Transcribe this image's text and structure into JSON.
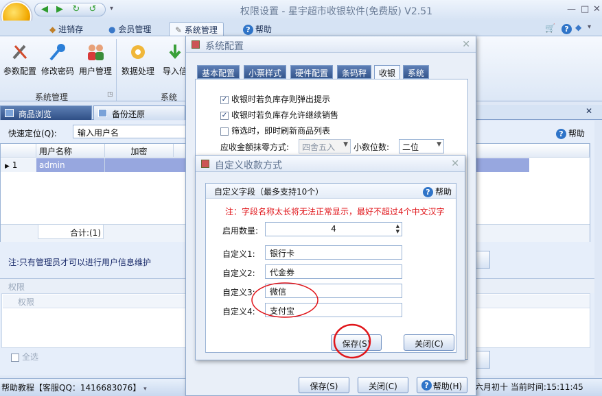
{
  "app": {
    "title": "权限设置 - 星宇超市收银软件(免费版) V2.51",
    "minimize": "—",
    "restore": "□",
    "close": "✕",
    "quick_access": [
      "◀",
      "▶",
      "↻",
      "↺"
    ]
  },
  "ribbon_tabs": [
    {
      "label": "进销存"
    },
    {
      "label": "会员管理"
    },
    {
      "label": "系统管理"
    },
    {
      "label": "帮助"
    }
  ],
  "ribbon": {
    "buttons": [
      {
        "label": "参数配置"
      },
      {
        "label": "修改密码"
      },
      {
        "label": "用户管理"
      },
      {
        "label": "数据处理"
      },
      {
        "label": "导入信"
      }
    ],
    "groups": [
      {
        "label": "系统管理"
      },
      {
        "label": "系统"
      }
    ]
  },
  "doc_tabs": [
    {
      "label": "商品浏览"
    },
    {
      "label": "备份还原"
    }
  ],
  "main": {
    "quick_locate_label": "快速定位(Q):",
    "quick_locate_value": "输入用户名",
    "help_label": "帮助",
    "grid": {
      "columns": [
        "用户名称",
        "加密"
      ],
      "rows": [
        {
          "index": "1",
          "name": "admin",
          "encrypt": ""
        }
      ],
      "total_label": "合计:(1)"
    },
    "admin_note": "注:只有管理员才可以进行用户信息维护",
    "perm_header": "权限",
    "perm_column": "权限",
    "select_all": "全选"
  },
  "status": {
    "left": "帮助教程【客服QQ：1416683076】",
    "right": "六月初十 当前时间:15:11:45"
  },
  "dialog_config": {
    "title": "系统配置",
    "tabs": [
      "基本配置",
      "小票样式",
      "硬件配置",
      "条码秤",
      "收银",
      "系统"
    ],
    "active_tab": "收银",
    "options": [
      {
        "label": "收银时若负库存则弹出提示",
        "checked": true
      },
      {
        "label": "收银时若负库存允许继续销售",
        "checked": true
      },
      {
        "label": "筛选时，即时刷新商品列表",
        "checked": false
      }
    ],
    "round_label": "应收金额抹零方式:",
    "round_value": "四舍五入",
    "decimal_label": "小数位数:",
    "decimal_value": "二位",
    "save_label": "保存(S)",
    "close_label": "关闭(C)",
    "help_label": "帮助(H)"
  },
  "dialog_custom": {
    "title": "自定义收款方式",
    "group_title": "自定义字段（最多支持10个）",
    "help_label": "帮助",
    "warning": "注：字段名称太长将无法正常显示，最好不超过4个中文汉字",
    "enable_label": "启用数量:",
    "enable_value": "4",
    "fields": [
      {
        "label": "自定义1:",
        "value": "银行卡"
      },
      {
        "label": "自定义2:",
        "value": "代金券"
      },
      {
        "label": "自定义3:",
        "value": "微信"
      },
      {
        "label": "自定义4:",
        "value": "支付宝"
      }
    ],
    "save_label": "保存(S)",
    "close_label": "关闭(C)"
  },
  "colors": {
    "annotation_red": "#e0151a",
    "selected_row": "#97a7df",
    "accent_blue": "#2f74c8"
  }
}
